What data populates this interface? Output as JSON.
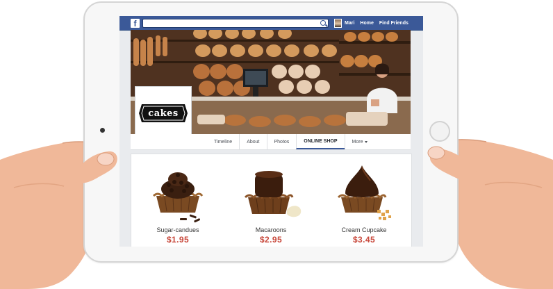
{
  "topbar": {
    "logo": "f",
    "search_placeholder": "",
    "user_name": "Mari",
    "home_label": "Home",
    "find_friends_label": "Find Friends",
    "bar_color": "#3b5998"
  },
  "profile": {
    "logo_text": "cakes"
  },
  "tabs": [
    {
      "label": "Timeline"
    },
    {
      "label": "About"
    },
    {
      "label": "Photos"
    },
    {
      "label": "ONLINE SHOP"
    },
    {
      "label": "More"
    }
  ],
  "products": [
    {
      "name": "Sugar-candues",
      "price": "$1.95"
    },
    {
      "name": "Macaroons",
      "price": "$2.95"
    },
    {
      "name": "Cream Cupcake",
      "price": "$3.45"
    }
  ],
  "colors": {
    "price": "#c8483b",
    "accent": "#3b5998"
  }
}
